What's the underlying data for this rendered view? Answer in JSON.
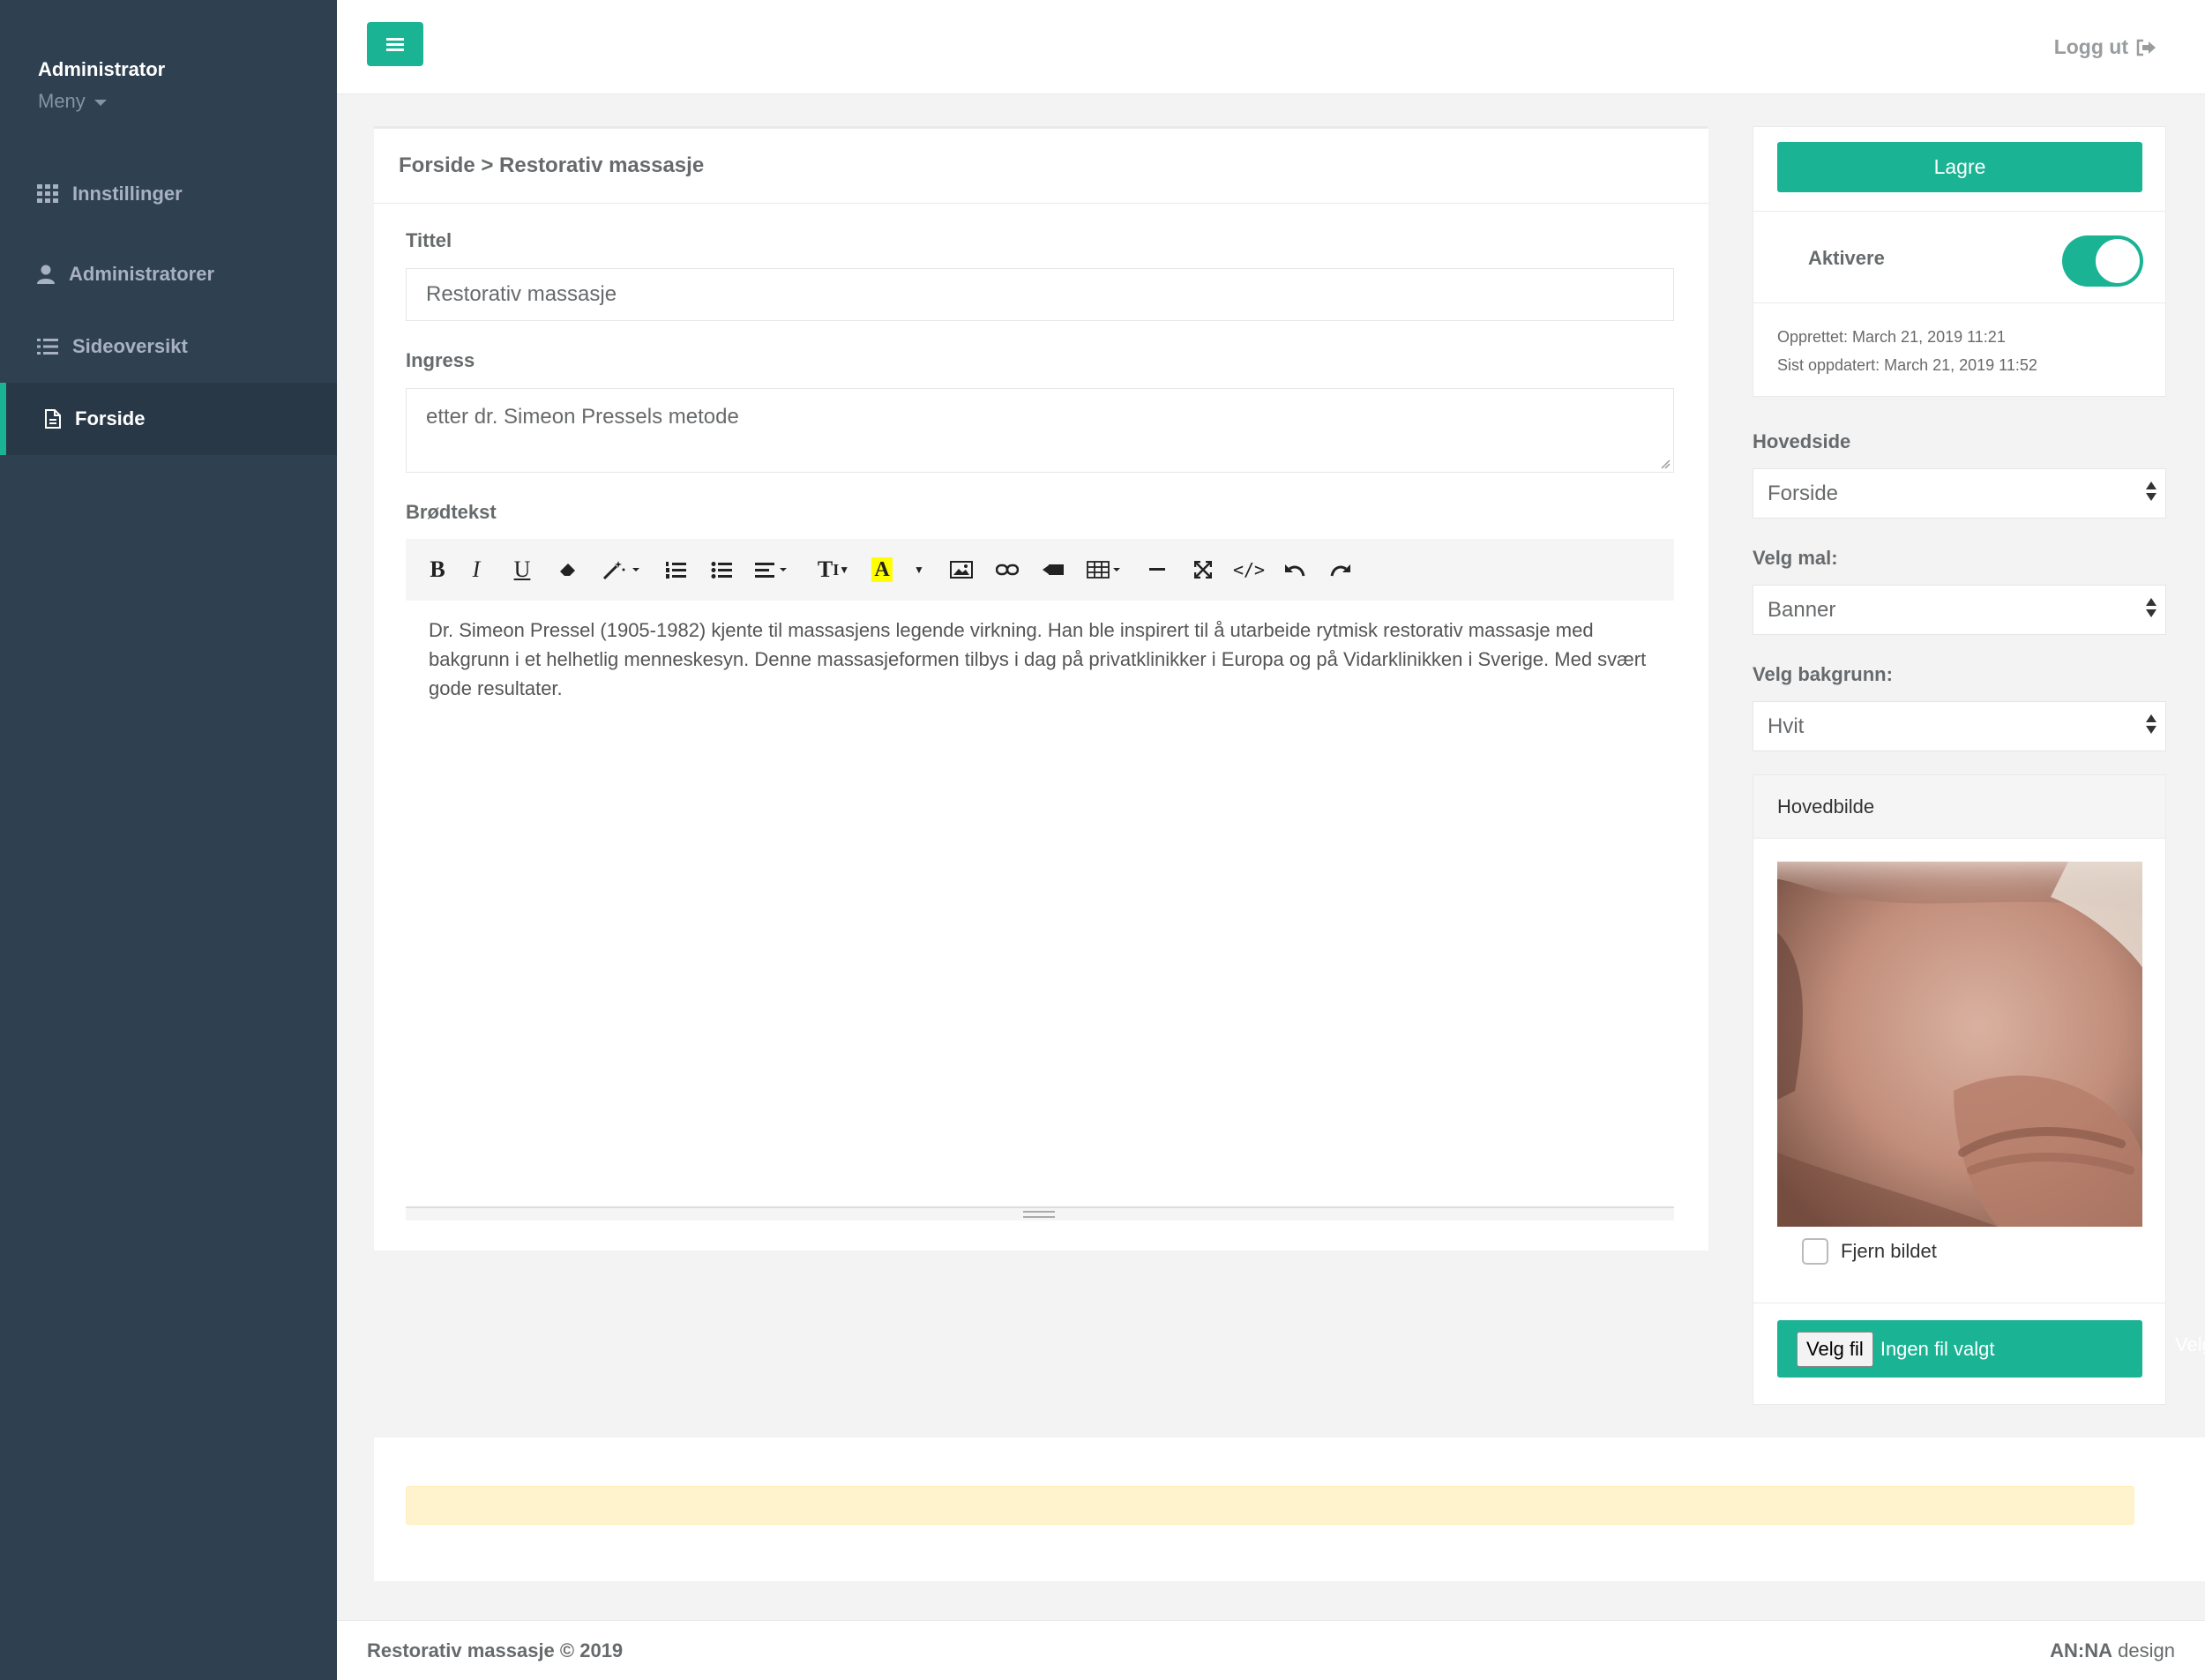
{
  "sidebar": {
    "profile_name": "Administrator",
    "profile_menu": "Meny",
    "items": [
      {
        "label": "Innstillinger",
        "icon": "grid-icon"
      },
      {
        "label": "Administratorer",
        "icon": "user-icon"
      },
      {
        "label": "Sideoversikt",
        "icon": "list-icon"
      },
      {
        "label": "Forside",
        "icon": "file-icon",
        "active": true
      }
    ]
  },
  "topbar": {
    "logout_label": "Logg ut"
  },
  "main": {
    "breadcrumb": "Forside > Restorativ massasje",
    "title_label": "Tittel",
    "title_value": "Restorativ massasje",
    "ingress_label": "Ingress",
    "ingress_value": "etter dr. Simeon Pressels metode",
    "body_label": "Brødtekst",
    "body_text": "Dr. Simeon Pressel (1905-1982) kjente til massasjens legende virkning. Han ble inspirert til å utarbeide rytmisk restorativ  massasje  med bakgrunn i et helhetlig menneskesyn. Denne massasjeformen tilbys i dag på privatklinikker i Europa og på Vidarklinikken i Sverige. Med svært gode resultater.",
    "toolbar": [
      "bold",
      "italic",
      "underline",
      "eraser",
      "magic",
      "ordered-list",
      "unordered-list",
      "align",
      "font-size",
      "text-color",
      "color-dropdown",
      "picture",
      "link",
      "video",
      "table",
      "hr",
      "fullscreen",
      "code",
      "undo",
      "redo"
    ]
  },
  "right": {
    "save_label": "Lagre",
    "activate_label": "Aktivere",
    "activate_on": true,
    "created": "Opprettet: March 21, 2019 11:21",
    "updated": "Sist oppdatert: March 21, 2019 11:52",
    "hovedside_label": "Hovedside",
    "hovedside_value": "Forside",
    "mal_label": "Velg mal:",
    "mal_value": "Banner",
    "bakgrunn_label": "Velg bakgrunn:",
    "bakgrunn_value": "Hvit",
    "image_header": "Hovedbilde",
    "remove_image_label": "Fjern bildet",
    "file_button": "Velg fil",
    "file_status": "Ingen fil valgt",
    "overflow_text": "Velg"
  },
  "footer": {
    "left": "Restorativ massasje © 2019",
    "right_bold": "AN:NA",
    "right_rest": " design"
  },
  "colors": {
    "accent": "#1ab394",
    "sidebar": "#2f4050",
    "alert": "#fff3cd"
  }
}
